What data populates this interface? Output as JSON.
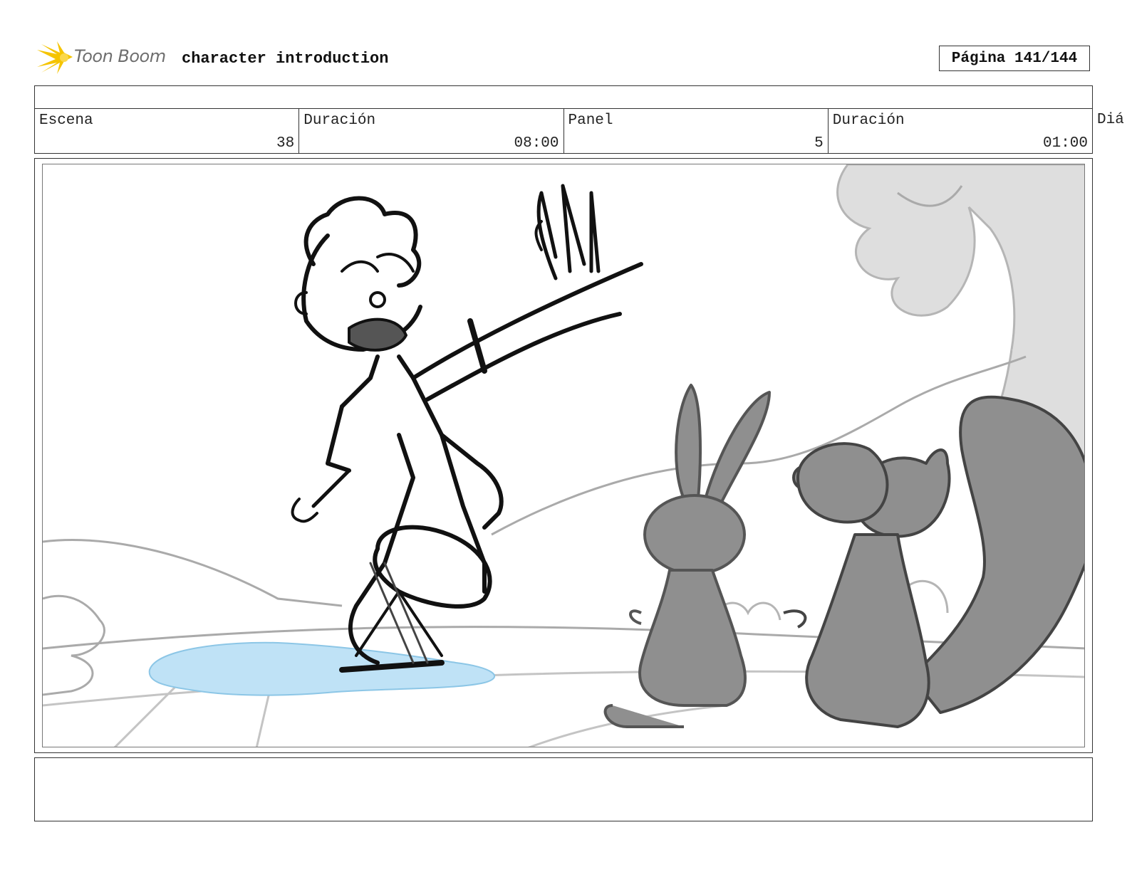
{
  "header": {
    "logo_text": "Toon Boom",
    "title": "character introduction",
    "page_label": "Página 141/144"
  },
  "info": {
    "scene_label": "Escena",
    "scene_value": "38",
    "scene_duration_label": "Duración",
    "scene_duration_value": "08:00",
    "panel_label": "Panel",
    "panel_value": "5",
    "panel_duration_label": "Duración",
    "panel_duration_value": "01:00",
    "overflow_label": "Diá"
  },
  "colors": {
    "logo_yellow": "#f5c400",
    "puddle_blue": "#bfe2f6",
    "animal_gray": "#8f8f8f",
    "tree_gray": "#dedede"
  },
  "icons": [
    "toon-boom-logo-icon"
  ],
  "panel": {
    "description": ""
  },
  "notes": {
    "text": ""
  }
}
